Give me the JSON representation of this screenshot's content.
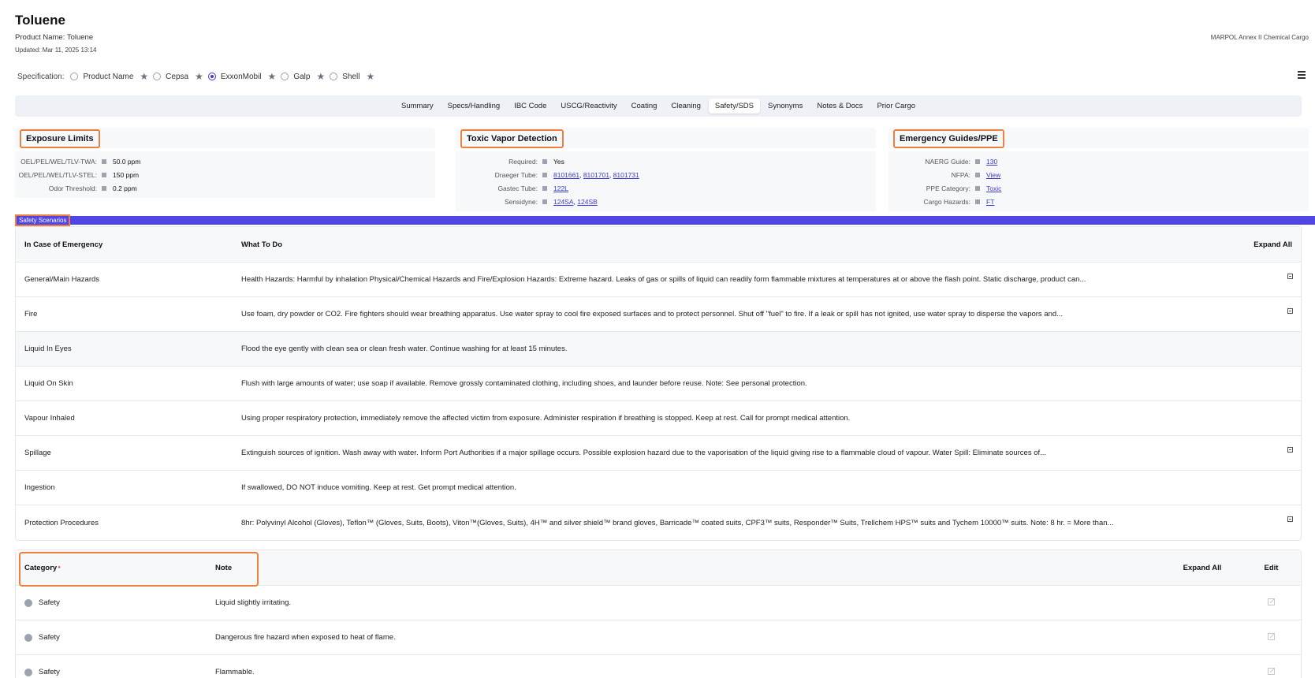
{
  "header": {
    "title": "Toluene",
    "product_name": "Product Name: Toluene",
    "updated": "Updated: Mar 11, 2025 13:14",
    "regulation": "MARPOL Annex II Chemical Cargo"
  },
  "specification": {
    "label": "Specification:",
    "options": [
      {
        "label": "Product Name",
        "checked": false
      },
      {
        "label": "Cepsa",
        "checked": false
      },
      {
        "label": "ExxonMobil",
        "checked": true
      },
      {
        "label": "Galp",
        "checked": false
      },
      {
        "label": "Shell",
        "checked": false
      }
    ],
    "icons": {
      "star": "star-icon",
      "menu": "menu-icon"
    }
  },
  "tabs": [
    "Summary",
    "Specs/Handling",
    "IBC Code",
    "USCG/Reactivity",
    "Coating",
    "Cleaning",
    "Safety/SDS",
    "Synonyms",
    "Notes & Docs",
    "Prior Cargo"
  ],
  "active_tab": "Safety/SDS",
  "exposure_limits": {
    "title": "Exposure Limits",
    "rows": [
      {
        "key": "OEL/PEL/WEL/TLV-TWA:",
        "value": "50.0 ppm"
      },
      {
        "key": "OEL/PEL/WEL/TLV-STEL:",
        "value": "150 ppm"
      },
      {
        "key": "Odor Threshold:",
        "value": "0.2 ppm"
      }
    ]
  },
  "toxic_vapor": {
    "title": "Toxic Vapor Detection",
    "required_key": "Required:",
    "required_value": "Yes",
    "draeger_key": "Draeger Tube:",
    "draeger_links": [
      "8101661",
      "8101701",
      "8101731"
    ],
    "gastec_key": "Gastec Tube:",
    "gastec_link": "122L",
    "sensidyne_key": "Sensidyne:",
    "sensidyne_links": [
      "124SA",
      "124SB"
    ]
  },
  "emergency_guides": {
    "title": "Emergency Guides/PPE",
    "rows": [
      {
        "key": "NAERG Guide:",
        "value": "130"
      },
      {
        "key": "NFPA:",
        "value": "View"
      },
      {
        "key": "PPE Category:",
        "value": "Toxic"
      },
      {
        "key": "Cargo Hazards:",
        "value": "FT"
      }
    ]
  },
  "safety_scenarios": {
    "label": "Safety Scenarios",
    "header": {
      "emergency": "In Case of Emergency",
      "what": "What To Do",
      "expand": "Expand All"
    },
    "rows": [
      {
        "emergency": "General/Main Hazards",
        "what": "Health Hazards: Harmful by inhalation Physical/Chemical Hazards and Fire/Explosion Hazards: Extreme hazard. Leaks of gas or spills of liquid can readily form flammable mixtures at temperatures at or above the flash point. Static discharge, product can...",
        "expandable": true,
        "alt": false
      },
      {
        "emergency": "Fire",
        "what": "Use foam, dry powder or CO2. Fire fighters should wear breathing apparatus. Use water spray to cool fire exposed surfaces and to protect personnel. Shut off \"fuel\" to fire. If a leak or spill has not ignited, use water spray to disperse the vapors and...",
        "expandable": true,
        "alt": false
      },
      {
        "emergency": "Liquid In Eyes",
        "what": "Flood the eye gently with clean sea or clean fresh water. Continue washing for at least 15 minutes.",
        "expandable": false,
        "alt": true
      },
      {
        "emergency": "Liquid On Skin",
        "what": "Flush with large amounts of water; use soap if available. Remove grossly contaminated clothing, including shoes, and launder before reuse. Note: See personal protection.",
        "expandable": false,
        "alt": false
      },
      {
        "emergency": "Vapour Inhaled",
        "what": "Using proper respiratory protection, immediately remove the affected victim from exposure. Administer respiration if breathing is stopped. Keep at rest. Call for prompt medical attention.",
        "expandable": false,
        "alt": false
      },
      {
        "emergency": "Spillage",
        "what": "Extinguish sources of ignition. Wash away with water. Inform Port Authorities if a major spillage occurs. Possible explosion hazard due to the vaporisation of the liquid giving rise to a flammable cloud of vapour. Water Spill: Eliminate sources of...",
        "expandable": true,
        "alt": false
      },
      {
        "emergency": "Ingestion",
        "what": "If swallowed, DO NOT induce vomiting. Keep at rest. Get prompt medical attention.",
        "expandable": false,
        "alt": false
      },
      {
        "emergency": "Protection Procedures",
        "what": "8hr: Polyvinyl Alcohol (Gloves), Teflon™ (Gloves, Suits, Boots), Viton™(Gloves, Suits), 4H™ and silver shield™ brand gloves, Barricade™ coated suits, CPF3™ suits, Responder™ Suits, Trellchem HPS™ suits and Tychem 10000™ suits. Note: 8 hr. = More than...",
        "expandable": true,
        "alt": false
      }
    ]
  },
  "notes_table": {
    "header": {
      "category": "Category",
      "note": "Note",
      "expand": "Expand All",
      "edit": "Edit"
    },
    "rows": [
      {
        "category": "Safety",
        "note": "Liquid slightly irritating."
      },
      {
        "category": "Safety",
        "note": "Dangerous fire hazard when exposed to heat of flame."
      },
      {
        "category": "Safety",
        "note": "Flammable."
      }
    ]
  },
  "colors": {
    "accent": "#4f46e5",
    "highlight": "#f07f3c",
    "link": "#3b3bd4"
  }
}
